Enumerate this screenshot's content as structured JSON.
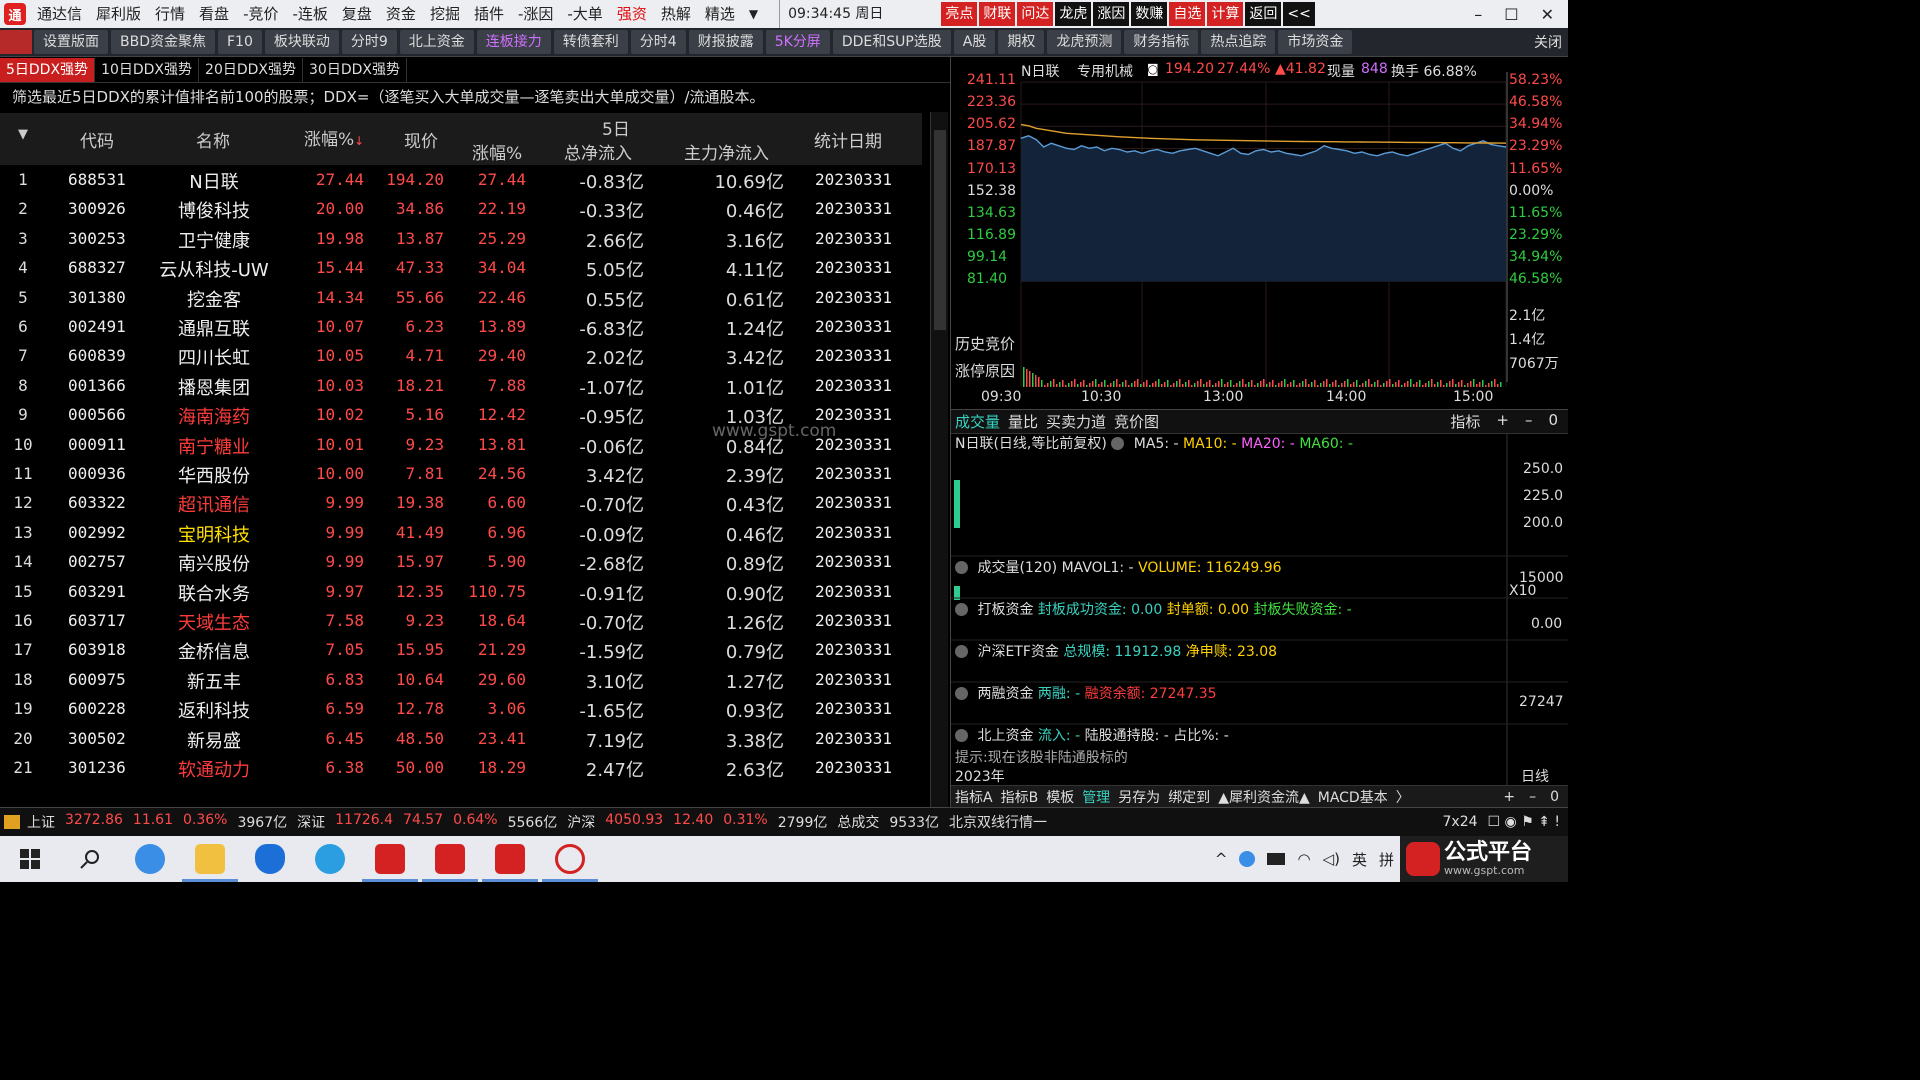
{
  "titlebar": {
    "logo": "通",
    "menus": [
      "通达信",
      "犀利版",
      "行情",
      "看盘",
      "-竞价",
      "-连板",
      "复盘",
      "资金",
      "挖掘",
      "插件",
      "-涨因",
      "-大单",
      "强资",
      "热解",
      "精选"
    ],
    "dropdown": "▼",
    "clock": "09:34:45 周日",
    "red_buttons": [
      "亮点",
      "财联",
      "问达",
      "龙虎",
      "涨因",
      "数赚",
      "自选",
      "计算",
      "返回",
      "<<"
    ],
    "win_min": "–",
    "win_max": "☐",
    "win_close": "✕"
  },
  "tabbar": {
    "tabs": [
      "设置版面",
      "BBD资金聚焦",
      "F10",
      "板块联动",
      "分时9",
      "北上资金",
      "连板接力",
      "转债套利",
      "分时4",
      "财报披露",
      "5K分屏",
      "DDE和SUP选股",
      "A股",
      "期权",
      "龙虎预测",
      "财务指标",
      "热点追踪",
      "市场资金"
    ],
    "close": "关闭"
  },
  "left": {
    "subtabs": [
      "5日DDX强势",
      "10日DDX强势",
      "20日DDX强势",
      "30日DDX强势"
    ],
    "description": "筛选最近5日DDX的累计值排名前100的股票；DDX=（逐笔买入大单成交量—逐笔卖出大单成交量）/流通股本。",
    "headers": {
      "code": "代码",
      "name": "名称",
      "pct": "涨幅%",
      "sort": "↓",
      "price": "现价",
      "d5": "5日",
      "pct5": "涨幅%",
      "flow5": "总净流入",
      "main": "主力净流入",
      "date": "统计日期"
    },
    "watermark": "www.gspt.com",
    "rows": [
      {
        "i": "1",
        "code": "688531",
        "name": "N日联",
        "pct": "27.44",
        "price": "194.20",
        "pct5": "27.44",
        "flow5": "-0.83亿",
        "main": "10.69亿",
        "date": "20230331",
        "nc": "#eeeeee"
      },
      {
        "i": "2",
        "code": "300926",
        "name": "博俊科技",
        "pct": "20.00",
        "price": "34.86",
        "pct5": "22.19",
        "flow5": "-0.33亿",
        "main": "0.46亿",
        "date": "20230331",
        "nc": "#eeeeee"
      },
      {
        "i": "3",
        "code": "300253",
        "name": "卫宁健康",
        "pct": "19.98",
        "price": "13.87",
        "pct5": "25.29",
        "flow5": "2.66亿",
        "main": "3.16亿",
        "date": "20230331",
        "nc": "#eeeeee"
      },
      {
        "i": "4",
        "code": "688327",
        "name": "云从科技-UW",
        "pct": "15.44",
        "price": "47.33",
        "pct5": "34.04",
        "flow5": "5.05亿",
        "main": "4.11亿",
        "date": "20230331",
        "nc": "#eeeeee"
      },
      {
        "i": "5",
        "code": "301380",
        "name": "挖金客",
        "pct": "14.34",
        "price": "55.66",
        "pct5": "22.46",
        "flow5": "0.55亿",
        "main": "0.61亿",
        "date": "20230331",
        "nc": "#eeeeee"
      },
      {
        "i": "6",
        "code": "002491",
        "name": "通鼎互联",
        "pct": "10.07",
        "price": "6.23",
        "pct5": "13.89",
        "flow5": "-6.83亿",
        "main": "1.24亿",
        "date": "20230331",
        "nc": "#eeeeee"
      },
      {
        "i": "7",
        "code": "600839",
        "name": "四川长虹",
        "pct": "10.05",
        "price": "4.71",
        "pct5": "29.40",
        "flow5": "2.02亿",
        "main": "3.42亿",
        "date": "20230331",
        "nc": "#eeeeee"
      },
      {
        "i": "8",
        "code": "001366",
        "name": "播恩集团",
        "pct": "10.03",
        "price": "18.21",
        "pct5": "7.88",
        "flow5": "-1.07亿",
        "main": "1.01亿",
        "date": "20230331",
        "nc": "#eeeeee"
      },
      {
        "i": "9",
        "code": "000566",
        "name": "海南海药",
        "pct": "10.02",
        "price": "5.16",
        "pct5": "12.42",
        "flow5": "-0.95亿",
        "main": "1.03亿",
        "date": "20230331",
        "nc": "#ff3c3c"
      },
      {
        "i": "10",
        "code": "000911",
        "name": "南宁糖业",
        "pct": "10.01",
        "price": "9.23",
        "pct5": "13.81",
        "flow5": "-0.06亿",
        "main": "0.84亿",
        "date": "20230331",
        "nc": "#ff3c3c"
      },
      {
        "i": "11",
        "code": "000936",
        "name": "华西股份",
        "pct": "10.00",
        "price": "7.81",
        "pct5": "24.56",
        "flow5": "3.42亿",
        "main": "2.39亿",
        "date": "20230331",
        "nc": "#eeeeee"
      },
      {
        "i": "12",
        "code": "603322",
        "name": "超讯通信",
        "pct": "9.99",
        "price": "19.38",
        "pct5": "6.60",
        "flow5": "-0.70亿",
        "main": "0.43亿",
        "date": "20230331",
        "nc": "#ff3c3c"
      },
      {
        "i": "13",
        "code": "002992",
        "name": "宝明科技",
        "pct": "9.99",
        "price": "41.49",
        "pct5": "6.96",
        "flow5": "-0.09亿",
        "main": "0.46亿",
        "date": "20230331",
        "nc": "#ffe000"
      },
      {
        "i": "14",
        "code": "002757",
        "name": "南兴股份",
        "pct": "9.99",
        "price": "15.97",
        "pct5": "5.90",
        "flow5": "-2.68亿",
        "main": "0.89亿",
        "date": "20230331",
        "nc": "#eeeeee"
      },
      {
        "i": "15",
        "code": "603291",
        "name": "联合水务",
        "pct": "9.97",
        "price": "12.35",
        "pct5": "110.75",
        "flow5": "-0.91亿",
        "main": "0.90亿",
        "date": "20230331",
        "nc": "#eeeeee"
      },
      {
        "i": "16",
        "code": "603717",
        "name": "天域生态",
        "pct": "7.58",
        "price": "9.23",
        "pct5": "18.64",
        "flow5": "-0.70亿",
        "main": "1.26亿",
        "date": "20230331",
        "nc": "#ff3c3c"
      },
      {
        "i": "17",
        "code": "603918",
        "name": "金桥信息",
        "pct": "7.05",
        "price": "15.95",
        "pct5": "21.29",
        "flow5": "-1.59亿",
        "main": "0.79亿",
        "date": "20230331",
        "nc": "#eeeeee"
      },
      {
        "i": "18",
        "code": "600975",
        "name": "新五丰",
        "pct": "6.83",
        "price": "10.64",
        "pct5": "29.60",
        "flow5": "3.10亿",
        "main": "1.27亿",
        "date": "20230331",
        "nc": "#eeeeee"
      },
      {
        "i": "19",
        "code": "600228",
        "name": "返利科技",
        "pct": "6.59",
        "price": "12.78",
        "pct5": "3.06",
        "flow5": "-1.65亿",
        "main": "0.93亿",
        "date": "20230331",
        "nc": "#eeeeee"
      },
      {
        "i": "20",
        "code": "300502",
        "name": "新易盛",
        "pct": "6.45",
        "price": "48.50",
        "pct5": "23.41",
        "flow5": "7.19亿",
        "main": "3.38亿",
        "date": "20230331",
        "nc": "#eeeeee"
      },
      {
        "i": "21",
        "code": "301236",
        "name": "软通动力",
        "pct": "6.38",
        "price": "50.00",
        "pct5": "18.29",
        "flow5": "2.47亿",
        "main": "2.63亿",
        "date": "20230331",
        "nc": "#ff3c3c"
      }
    ]
  },
  "chart": {
    "header": {
      "name": "N日联",
      "industry": "专用机械",
      "price": "194.20",
      "pct": "27.44%",
      "change": "▲41.82",
      "now": "现量",
      "now_val": "848",
      "turnover": "换手 66.88%"
    },
    "left_ticks": [
      "241.11",
      "223.36",
      "205.62",
      "187.87",
      "170.13",
      "152.38",
      "134.63",
      "116.89",
      "99.14",
      "81.40"
    ],
    "right_ticks": [
      "58.23%",
      "46.58%",
      "34.94%",
      "23.29%",
      "11.65%",
      "0.00%",
      "11.65%",
      "23.29%",
      "34.94%",
      "46.58%"
    ],
    "vol_ticks": [
      "2.1亿",
      "1.4亿",
      "7067万"
    ],
    "time_ticks": [
      "09:30",
      "10:30",
      "13:00",
      "14:00",
      "15:00"
    ],
    "side_buttons": [
      "历史竞价",
      "涨停原因"
    ],
    "open_price": 152.38,
    "y_range": [
      81.4,
      241.11
    ],
    "price_series": [
      196,
      198,
      195,
      189,
      192,
      190,
      188,
      187,
      190,
      188,
      189,
      186,
      188,
      187,
      185,
      186,
      184,
      186,
      187,
      185,
      184,
      186,
      187,
      188,
      186,
      184,
      182,
      185,
      188,
      184,
      183,
      186,
      187,
      185,
      186,
      184,
      183,
      182,
      184,
      186,
      190,
      188,
      187,
      186,
      184,
      185,
      183,
      182,
      184,
      185,
      183,
      182,
      184,
      186,
      188,
      190,
      192,
      188,
      186,
      190,
      192,
      194,
      191,
      190,
      189
    ],
    "avg_series": [
      207,
      206,
      204,
      203,
      202,
      201,
      200,
      199.6,
      199.2,
      198.8,
      198.4,
      198,
      197.6,
      197.2,
      196.9,
      196.6,
      196.3,
      196,
      195.8,
      195.6,
      195.4,
      195.2,
      195,
      194.8,
      194.7,
      194.6,
      194.5,
      194.4,
      194.3,
      194.2,
      194.1,
      194,
      193.9,
      193.8,
      193.7,
      193.6,
      193.5,
      193.45,
      193.4,
      193.35,
      193.3,
      193.25,
      193.2,
      193.15,
      193.1,
      193.05,
      193,
      192.95,
      192.9,
      192.85,
      192.8,
      192.75,
      192.7,
      192.65,
      192.6,
      192.55,
      192.5,
      192.45,
      192.4,
      192.35,
      192.3,
      192.25,
      192.2,
      192.15,
      192.1
    ]
  },
  "bottom": {
    "tabs": [
      "成交量",
      "量比",
      "买卖力道",
      "竞价图"
    ],
    "tools": [
      "指标",
      "+",
      "–",
      "0"
    ],
    "kline_title": "N日联(日线,等比前复权)",
    "ma": [
      "MA5: -",
      "MA10: -",
      "MA20: -",
      "MA60: -"
    ],
    "k_ticks": [
      "250.0",
      "225.0",
      "200.0"
    ],
    "vol_line": {
      "label": "成交量(120)",
      "mavol": "MAVOL1: -",
      "volume": "VOLUME: 116249.96",
      "tick": "15000",
      "x": "X10"
    },
    "daban": {
      "label": "打板资金",
      "a": "封板成功资金: 0.00",
      "b": "封单额: 0.00",
      "c": "封板失败资金: -",
      "tick": "0.00"
    },
    "etf": {
      "label": "沪深ETF资金",
      "a": "总规模: 11912.98",
      "b": "净申赎: 23.08"
    },
    "margin": {
      "label": "两融资金",
      "a": "两融: -",
      "b": "融资余额: 27247.35",
      "tick": "27247"
    },
    "north": {
      "label": "北上资金",
      "a": "流入: -",
      "b": "陆股通持股: -",
      "c": "占比%: -"
    },
    "hint": "提示:现在该股非陆通股标的",
    "year": "2023年",
    "period": "日线",
    "bar_tabs": [
      "指标A",
      "指标B",
      "模板",
      "管理",
      "另存为",
      "绑定到",
      "▲犀利资金流▲",
      "MACD基本",
      "〉"
    ],
    "bar_tools": [
      "+",
      "–",
      "0"
    ]
  },
  "status": {
    "items": [
      {
        "t": "上证",
        "c": "#ddd"
      },
      {
        "t": "3272.86",
        "c": "#ff4a4a"
      },
      {
        "t": "11.61",
        "c": "#ff4a4a"
      },
      {
        "t": "0.36%",
        "c": "#ff4a4a"
      },
      {
        "t": "3967亿",
        "c": "#ddd"
      },
      {
        "t": "深证",
        "c": "#ddd"
      },
      {
        "t": "11726.4",
        "c": "#ff4a4a"
      },
      {
        "t": "74.57",
        "c": "#ff4a4a"
      },
      {
        "t": "0.64%",
        "c": "#ff4a4a"
      },
      {
        "t": "5566亿",
        "c": "#ddd"
      },
      {
        "t": "沪深",
        "c": "#ddd"
      },
      {
        "t": "4050.93",
        "c": "#ff4a4a"
      },
      {
        "t": "12.40",
        "c": "#ff4a4a"
      },
      {
        "t": "0.31%",
        "c": "#ff4a4a"
      },
      {
        "t": "2799亿",
        "c": "#ddd"
      },
      {
        "t": "总成交",
        "c": "#ddd"
      },
      {
        "t": "9533亿",
        "c": "#ddd"
      },
      {
        "t": "北京双线行情一",
        "c": "#ddd"
      }
    ],
    "right": "7x24"
  },
  "taskbar": {
    "tray": [
      "^",
      "英",
      "拼"
    ],
    "brand_big": "公式平台",
    "brand_url": "www.gspt.com"
  },
  "colors": {
    "up": "#ff4a4a",
    "down": "#2ecc40",
    "accent": "#c81e1e",
    "teal": "#39d2c0",
    "price_line": "#5b9bd5",
    "avg_line": "#e0a030"
  }
}
